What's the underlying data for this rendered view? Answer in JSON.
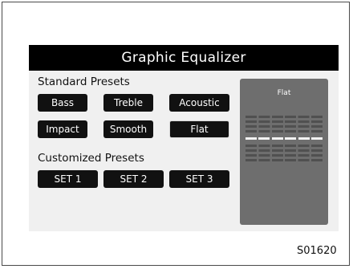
{
  "screen": {
    "title": "Graphic Equalizer",
    "standard_presets": {
      "label": "Standard Presets",
      "buttons": [
        "Bass",
        "Treble",
        "Acoustic",
        "Impact",
        "Smooth",
        "Flat"
      ],
      "selected": "Flat"
    },
    "customized_presets": {
      "label": "Customized Presets",
      "buttons": [
        "SET 1",
        "SET 2",
        "SET 3"
      ]
    },
    "eq_display": {
      "preset_name": "Flat",
      "bands": 6,
      "levels": [
        0,
        0,
        0,
        0,
        0,
        0
      ]
    }
  },
  "figure_code": "S01620"
}
